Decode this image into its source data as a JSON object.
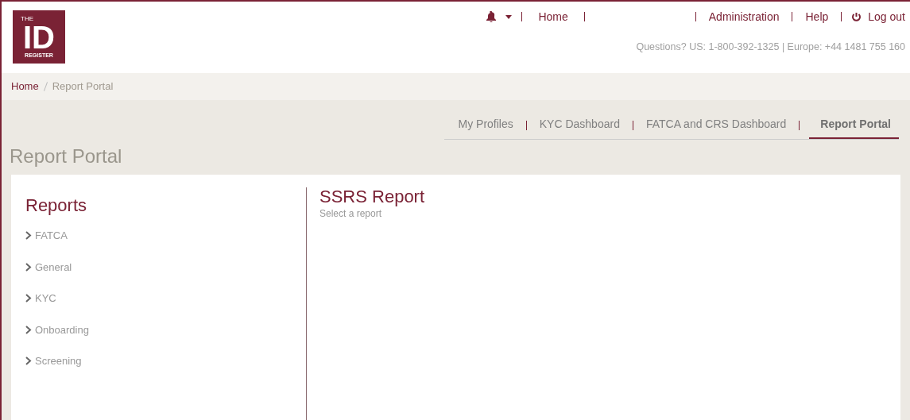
{
  "logo": {
    "small": "THE",
    "big": "ID",
    "bottom": "REGISTER"
  },
  "top_nav": {
    "left": [
      "Home"
    ],
    "right": [
      "Administration",
      "Help"
    ],
    "logout": "Log out"
  },
  "contact": "Questions? US: 1-800-392-1325 | Europe: +44 1481 755 160",
  "breadcrumb": [
    {
      "label": "Home",
      "current": false
    },
    {
      "label": "Report Portal",
      "current": true
    }
  ],
  "tabs": [
    {
      "label": "My Profiles",
      "selected": false
    },
    {
      "label": "KYC Dashboard",
      "selected": false
    },
    {
      "label": "FATCA and CRS Dashboard",
      "selected": false
    },
    {
      "label": "Report Portal",
      "selected": true
    }
  ],
  "page_title": "Report Portal",
  "reports": {
    "title": "Reports",
    "items": [
      {
        "label": "FATCA",
        "expanded": false
      },
      {
        "label": "General",
        "expanded": false
      },
      {
        "label": "KYC",
        "expanded": false
      },
      {
        "label": "Onboarding",
        "expanded": false
      },
      {
        "label": "Screening",
        "expanded": false
      }
    ]
  },
  "report_view": {
    "title": "SSRS Report",
    "subtitle": "Select a report"
  }
}
